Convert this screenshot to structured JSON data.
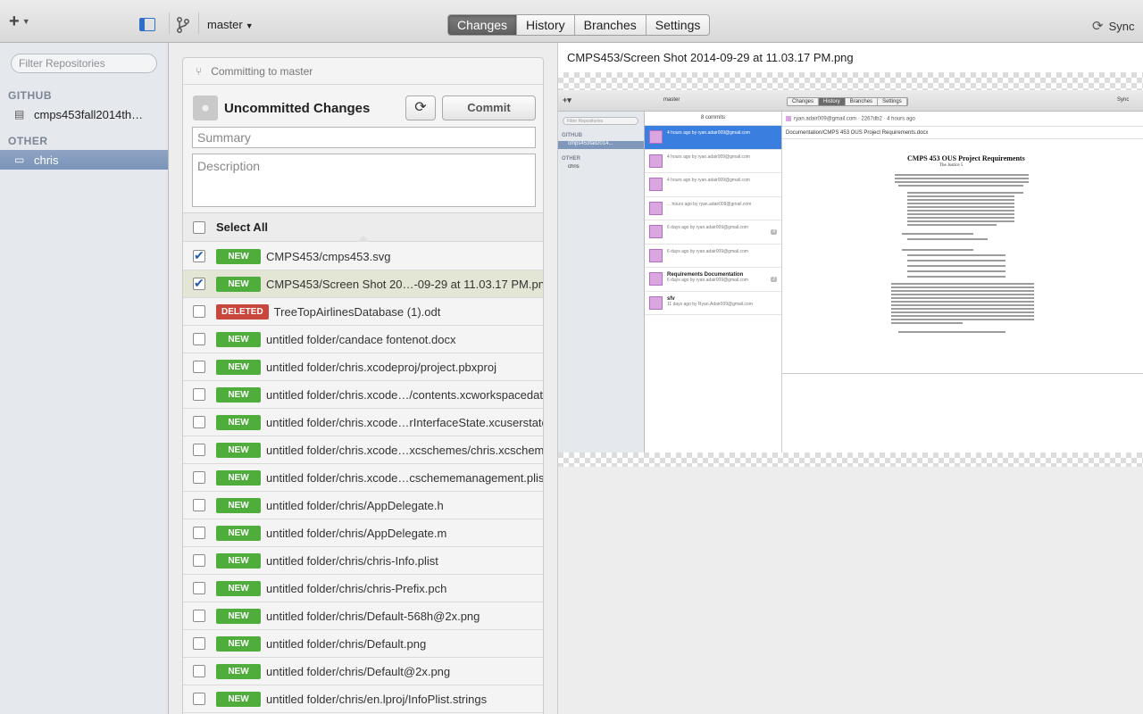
{
  "toolbar": {
    "add_icon": "plus-icon",
    "branch_name": "master",
    "tabs": [
      {
        "label": "Changes",
        "active": true
      },
      {
        "label": "History",
        "active": false
      },
      {
        "label": "Branches",
        "active": false
      },
      {
        "label": "Settings",
        "active": false
      }
    ],
    "sync_label": "Sync"
  },
  "sidebar": {
    "filter_placeholder": "Filter Repositories",
    "groups": [
      {
        "label": "GITHUB",
        "repos": [
          {
            "name": "cmps453fall2014th…",
            "icon": "book-icon",
            "selected": false
          }
        ]
      },
      {
        "label": "OTHER",
        "repos": [
          {
            "name": "chris",
            "icon": "computer-icon",
            "selected": true
          }
        ]
      }
    ]
  },
  "commit": {
    "header": "Committing to master",
    "title": "Uncommitted Changes",
    "commit_button": "Commit",
    "summary_placeholder": "Summary",
    "description_placeholder": "Description",
    "select_all": "Select All",
    "files": [
      {
        "status": "NEW",
        "name": "CMPS453/cmps453.svg",
        "checked": true,
        "highlighted": false
      },
      {
        "status": "NEW",
        "name": "CMPS453/Screen Shot 20…-09-29 at 11.03.17 PM.png",
        "checked": true,
        "highlighted": true
      },
      {
        "status": "DELETED",
        "name": "TreeTopAirlinesDatabase (1).odt",
        "checked": false,
        "highlighted": false
      },
      {
        "status": "NEW",
        "name": "untitled folder/candace fontenot.docx",
        "checked": false,
        "highlighted": false
      },
      {
        "status": "NEW",
        "name": "untitled folder/chris.xcodeproj/project.pbxproj",
        "checked": false,
        "highlighted": false
      },
      {
        "status": "NEW",
        "name": "untitled folder/chris.xcode…/contents.xcworkspacedata",
        "checked": false,
        "highlighted": false
      },
      {
        "status": "NEW",
        "name": "untitled folder/chris.xcode…rInterfaceState.xcuserstate",
        "checked": false,
        "highlighted": false
      },
      {
        "status": "NEW",
        "name": "untitled folder/chris.xcode…xcschemes/chris.xcscheme",
        "checked": false,
        "highlighted": false
      },
      {
        "status": "NEW",
        "name": "untitled folder/chris.xcode…cschememanagement.plist",
        "checked": false,
        "highlighted": false
      },
      {
        "status": "NEW",
        "name": "untitled folder/chris/AppDelegate.h",
        "checked": false,
        "highlighted": false
      },
      {
        "status": "NEW",
        "name": "untitled folder/chris/AppDelegate.m",
        "checked": false,
        "highlighted": false
      },
      {
        "status": "NEW",
        "name": "untitled folder/chris/chris-Info.plist",
        "checked": false,
        "highlighted": false
      },
      {
        "status": "NEW",
        "name": "untitled folder/chris/chris-Prefix.pch",
        "checked": false,
        "highlighted": false
      },
      {
        "status": "NEW",
        "name": "untitled folder/chris/Default-568h@2x.png",
        "checked": false,
        "highlighted": false
      },
      {
        "status": "NEW",
        "name": "untitled folder/chris/Default.png",
        "checked": false,
        "highlighted": false
      },
      {
        "status": "NEW",
        "name": "untitled folder/chris/Default@2x.png",
        "checked": false,
        "highlighted": false
      },
      {
        "status": "NEW",
        "name": "untitled folder/chris/en.lproj/InfoPlist.strings",
        "checked": false,
        "highlighted": false
      }
    ]
  },
  "preview": {
    "path": "CMPS453/Screen Shot 2014-09-29 at 11.03.17 PM.png",
    "inner": {
      "branch": "master",
      "tabs": [
        "Changes",
        "History",
        "Branches",
        "Settings"
      ],
      "sync": "Sync",
      "filter": "Filter Repositories",
      "group1": "GITHUB",
      "repo1": "cmps453fall2014...",
      "group2": "OTHER",
      "repo2": "chris",
      "commit_count": "8 commits",
      "commits": [
        {
          "title": "",
          "meta": "4 hours ago by ryan.adair009@gmail.com",
          "badge": ""
        },
        {
          "title": "",
          "meta": "4 hours ago by ryan.adair009@gmail.com",
          "badge": ""
        },
        {
          "title": "",
          "meta": "4 hours ago by ryan.adair009@gmail.com",
          "badge": ""
        },
        {
          "title": "",
          "meta": "... hours ago by ryan.adair009@gmail.com",
          "badge": ""
        },
        {
          "title": "",
          "meta": "6 days ago by ryan.adair009@gmail.com",
          "badge": "4"
        },
        {
          "title": "",
          "meta": "6 days ago by ryan.adair009@gmail.com",
          "badge": ""
        },
        {
          "title": "Requirements Documentation",
          "meta": "6 days ago by ryan.adair009@gmail.com",
          "badge": "2"
        },
        {
          "title": "sfv",
          "meta": "11 days ago by Ryan.Adair009@gmail.com",
          "badge": ""
        }
      ],
      "detail_author": "ryan.adair009@gmail.com",
      "detail_sha": "2267db2",
      "detail_time": "4 hours ago",
      "detail_file": "Documentation/CMPS 453 OUS Project Requirements.docx",
      "doc_title": "CMPS 453 OUS Project Requirements",
      "doc_subtitle": "The Justice 5"
    }
  }
}
